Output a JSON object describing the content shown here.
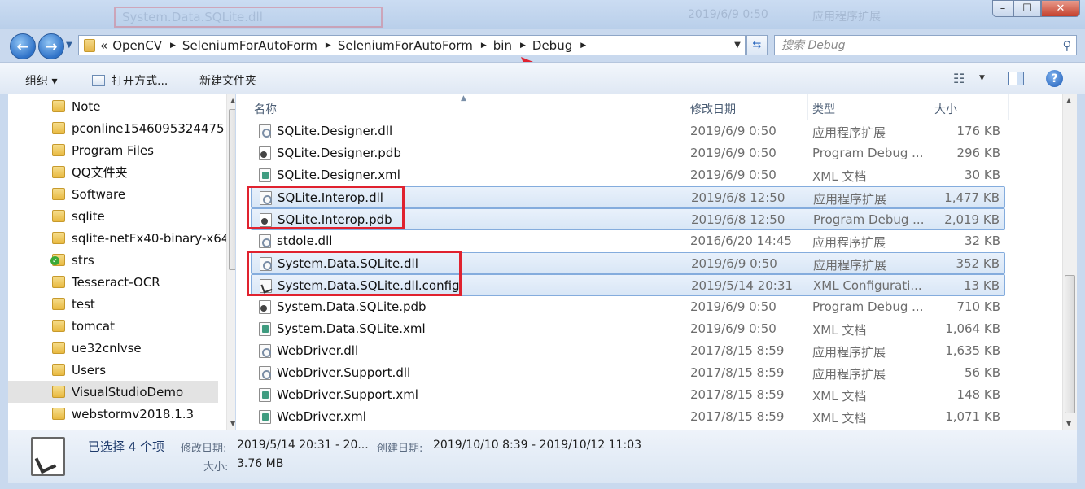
{
  "titlebar": {
    "ghost_title": "System.Data.SQLite.dll",
    "ghost_date": "2019/6/9 0:50",
    "ghost_type": "应用程序扩展",
    "buttons": {
      "minimize": "–",
      "maximize": "☐",
      "close": "✕"
    }
  },
  "address": {
    "overflow": "«",
    "crumbs": [
      "OpenCV",
      "SeleniumForAutoForm",
      "SeleniumForAutoForm",
      "bin",
      "Debug"
    ],
    "search_placeholder": "搜索 Debug"
  },
  "toolbar": {
    "organize": "组织 ▾",
    "open_with": "打开方式...",
    "new_folder": "新建文件夹"
  },
  "tree": [
    {
      "label": "Note"
    },
    {
      "label": "pconline1546095324475"
    },
    {
      "label": "Program Files"
    },
    {
      "label": "QQ文件夹"
    },
    {
      "label": "Software"
    },
    {
      "label": "sqlite"
    },
    {
      "label": "sqlite-netFx40-binary-x64"
    },
    {
      "label": "strs",
      "overlay": "svn-check"
    },
    {
      "label": "Tesseract-OCR"
    },
    {
      "label": "test"
    },
    {
      "label": "tomcat"
    },
    {
      "label": "ue32cnlvse"
    },
    {
      "label": "Users"
    },
    {
      "label": "VisualStudioDemo",
      "selected": true
    },
    {
      "label": "webstormv2018.1.3"
    }
  ],
  "columns": {
    "name": "名称",
    "date": "修改日期",
    "type": "类型",
    "size": "大小"
  },
  "files": [
    {
      "name": "SQLite.Designer.dll",
      "date": "2019/6/9 0:50",
      "type": "应用程序扩展",
      "size": "176 KB",
      "icon": "dll",
      "selected": false
    },
    {
      "name": "SQLite.Designer.pdb",
      "date": "2019/6/9 0:50",
      "type": "Program Debug ...",
      "size": "296 KB",
      "icon": "pdb",
      "selected": false
    },
    {
      "name": "SQLite.Designer.xml",
      "date": "2019/6/9 0:50",
      "type": "XML 文档",
      "size": "30 KB",
      "icon": "xml",
      "selected": false
    },
    {
      "name": "SQLite.Interop.dll",
      "date": "2019/6/8 12:50",
      "type": "应用程序扩展",
      "size": "1,477 KB",
      "icon": "dll",
      "selected": true
    },
    {
      "name": "SQLite.Interop.pdb",
      "date": "2019/6/8 12:50",
      "type": "Program Debug ...",
      "size": "2,019 KB",
      "icon": "pdb",
      "selected": true
    },
    {
      "name": "stdole.dll",
      "date": "2016/6/20 14:45",
      "type": "应用程序扩展",
      "size": "32 KB",
      "icon": "dll",
      "selected": false
    },
    {
      "name": "System.Data.SQLite.dll",
      "date": "2019/6/9 0:50",
      "type": "应用程序扩展",
      "size": "352 KB",
      "icon": "dll",
      "selected": true
    },
    {
      "name": "System.Data.SQLite.dll.config",
      "date": "2019/5/14 20:31",
      "type": "XML Configurati...",
      "size": "13 KB",
      "icon": "config",
      "selected": true
    },
    {
      "name": "System.Data.SQLite.pdb",
      "date": "2019/6/9 0:50",
      "type": "Program Debug ...",
      "size": "710 KB",
      "icon": "pdb",
      "selected": false
    },
    {
      "name": "System.Data.SQLite.xml",
      "date": "2019/6/9 0:50",
      "type": "XML 文档",
      "size": "1,064 KB",
      "icon": "xml",
      "selected": false
    },
    {
      "name": "WebDriver.dll",
      "date": "2017/8/15 8:59",
      "type": "应用程序扩展",
      "size": "1,635 KB",
      "icon": "dll",
      "selected": false
    },
    {
      "name": "WebDriver.Support.dll",
      "date": "2017/8/15 8:59",
      "type": "应用程序扩展",
      "size": "56 KB",
      "icon": "dll",
      "selected": false
    },
    {
      "name": "WebDriver.Support.xml",
      "date": "2017/8/15 8:59",
      "type": "XML 文档",
      "size": "148 KB",
      "icon": "xml",
      "selected": false
    },
    {
      "name": "WebDriver.xml",
      "date": "2017/8/15 8:59",
      "type": "XML 文档",
      "size": "1,071 KB",
      "icon": "xml",
      "selected": false
    }
  ],
  "details": {
    "selection_count": "已选择 4 个项",
    "modified_label": "修改日期:",
    "modified_value": "2019/5/14 20:31 - 20...",
    "created_label": "创建日期:",
    "created_value": "2019/10/10 8:39 - 2019/10/12 11:03",
    "size_label": "大小:",
    "size_value": "3.76 MB"
  },
  "colors": {
    "annotation_red": "#e0222f",
    "selection_blue": "#84acdd"
  }
}
